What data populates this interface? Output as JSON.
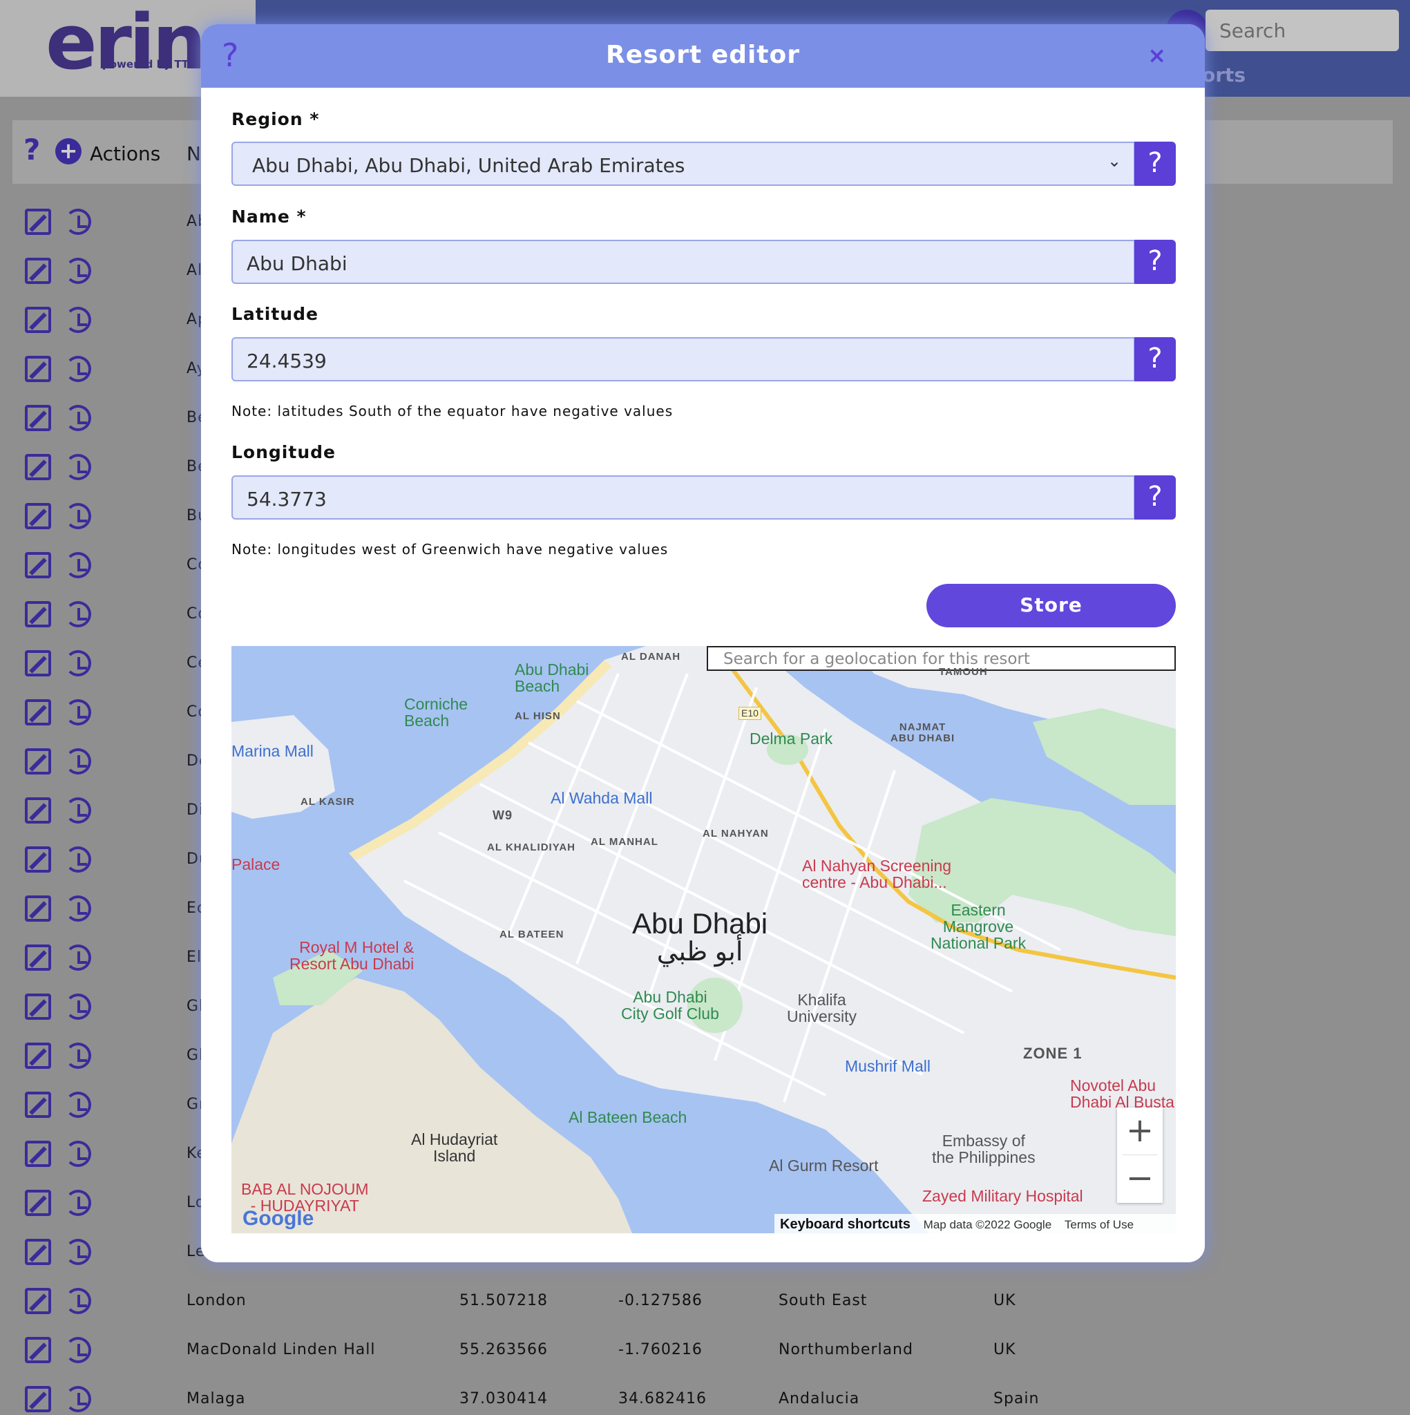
{
  "app": {
    "logo": "erin",
    "logo_sub": "powered by TTS",
    "search_placeholder": "Search",
    "nav_link": "orts"
  },
  "table": {
    "help": "?",
    "add": "+",
    "actions_label": "Actions",
    "name_header": "N",
    "rows_partial": [
      "Ab",
      "Al",
      "Ap",
      "Ay",
      "Be",
      "Be",
      "Bu",
      "Co",
      "Co",
      "Ce",
      "Co",
      "De",
      "Di",
      "Du",
      "Ec",
      "El",
      "Gl",
      "Gl",
      "Gr",
      "Ke",
      "Lo",
      "Le"
    ],
    "rows": [
      {
        "name": "London",
        "lat": "51.507218",
        "lng": "-0.127586",
        "region": "South East",
        "country": "UK"
      },
      {
        "name": "MacDonald Linden Hall",
        "lat": "55.263566",
        "lng": "-1.760216",
        "region": "Northumberland",
        "country": "UK"
      },
      {
        "name": "Malaga",
        "lat": "37.030414",
        "lng": "34.682416",
        "region": "Andalucia",
        "country": "Spain"
      }
    ]
  },
  "modal": {
    "title": "Resort editor",
    "help": "?",
    "close": "×",
    "region_label": "Region *",
    "region_value": "Abu Dhabi, Abu Dhabi, United Arab Emirates",
    "name_label": "Name *",
    "name_value": "Abu Dhabi",
    "latitude_label": "Latitude",
    "latitude_value": "24.4539",
    "latitude_note": "Note: latitudes South of the equator have negative values",
    "longitude_label": "Longitude",
    "longitude_value": "54.3773",
    "longitude_note": "Note: longitudes west of Greenwich have negative values",
    "store_label": "Store",
    "help_button": "?"
  },
  "map": {
    "search_placeholder": "Search for a geolocation for this resort",
    "city_name": "Abu Dhabi",
    "city_name_ar": "أبو ظبي",
    "footer_shortcuts": "Keyboard shortcuts",
    "footer_data": "Map data ©2022 Google",
    "footer_terms": "Terms of Use",
    "google": "Google",
    "zoom_in": "+",
    "zoom_out": "−",
    "labels": {
      "abu_dhabi_beach": "Abu Dhabi\nBeach",
      "corniche_beach": "Corniche\nBeach",
      "marina_mall": "Marina Mall",
      "delma_park": "Delma Park",
      "al_wahda_mall": "Al Wahda Mall",
      "al_nahyan_screening": "Al Nahyan Screening\ncentre - Abu Dhabi...",
      "eastern_mangrove": "Eastern\nMangrove\nNational Park",
      "palace": "Palace",
      "royal_m_hotel": "Royal M Hotel &\nResort Abu Dhabi",
      "golf_club": "Abu Dhabi\nCity Golf Club",
      "khalifa_univ": "Khalifa\nUniversity",
      "mushrif_mall": "Mushrif Mall",
      "novotel": "Novotel Abu\nDhabi Al Busta",
      "embassy": "Embassy of\nthe Philippines",
      "al_bateen_beach": "Al Bateen Beach",
      "al_gurm_resort": "Al Gurm Resort",
      "zayed_military": "Zayed Military Hospital",
      "hudayriat": "Al Hudayriat\nIsland",
      "bab_al_nojoum": "BAB AL NOJOUM\n- HUDAYRIYAT",
      "al_danah": "AL DANAH",
      "al_hisn": "AL HISN",
      "najmat": "NAJMAT\nABU DHABI",
      "al_kasir": "AL KASIR",
      "w9": "W9",
      "al_khalidiyah": "AL KHALIDIYAH",
      "al_manhal": "AL MANHAL",
      "al_nahyan": "AL NAHYAN",
      "al_bateen": "AL BATEEN",
      "zone1": "ZONE 1",
      "tamouh": "TAMOUH",
      "e10": "E10"
    }
  }
}
